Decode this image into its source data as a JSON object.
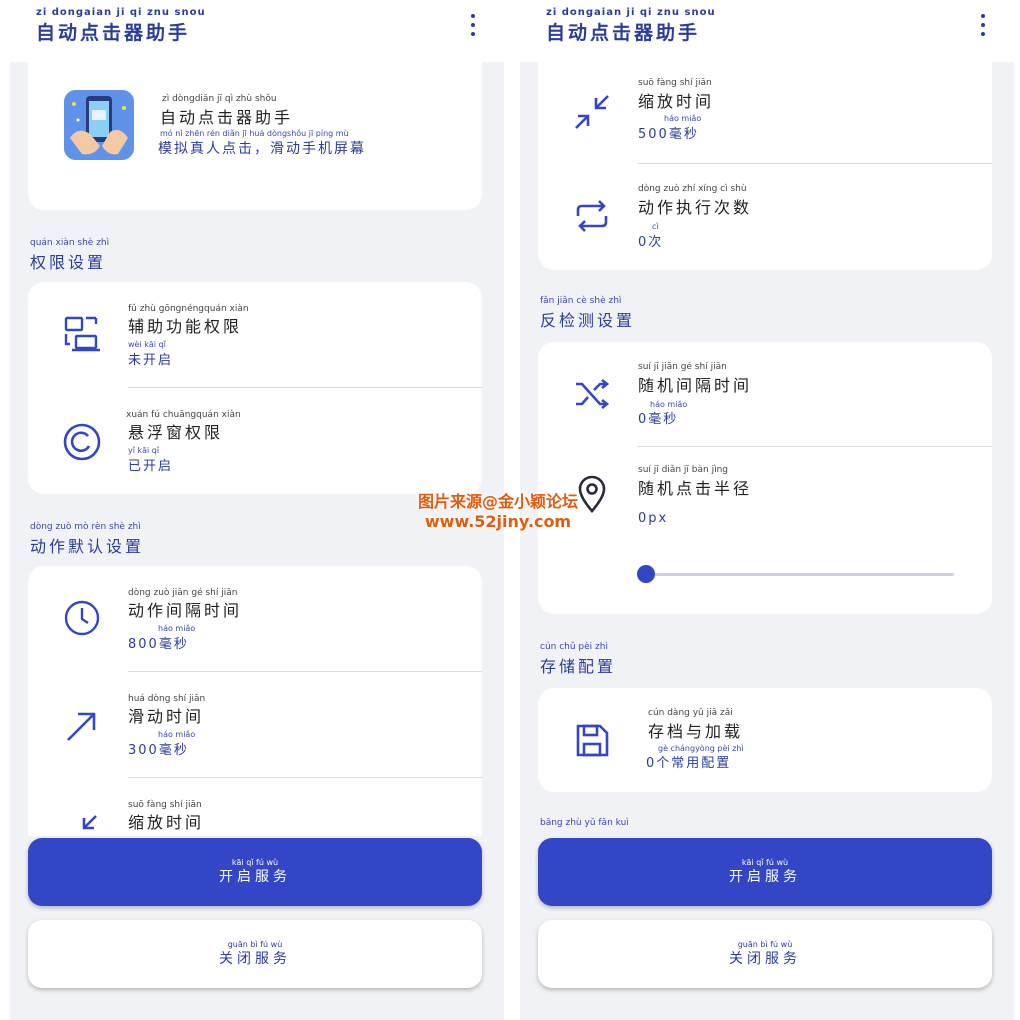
{
  "app": {
    "title_py": "zi  dongaian  ji   qi   znu snou",
    "title": "自动点击器助手"
  },
  "left": {
    "about": {
      "name_py": "zì  dòngdiǎn   jī    qì   zhù shǒu",
      "name": "自动点击器助手",
      "desc_py": "mó  nǐ  zhēn rén diǎn  jī        huá dòngshǒu   jī  píng mù",
      "desc": "模拟真人点击，滑动手机屏幕"
    },
    "perm_section": {
      "py": "quán xiàn  shè  zhì",
      "title": "权限设置"
    },
    "perm_items": [
      {
        "title_py": "fǔ   zhù  gōngnéngquán xiàn",
        "title": "辅助功能权限",
        "status_py": "wèi  kāi   qǐ",
        "status": "未开启",
        "icon": "accessibility-icon"
      },
      {
        "title_py": "xuán   fú   chuāngquán xiàn",
        "title": "悬浮窗权限",
        "status_py": "yǐ   kāi   qǐ",
        "status": "已开启",
        "icon": "float-window-icon"
      }
    ],
    "action_section": {
      "py": "dòng zuò  mò   rèn  shè  zhì",
      "title": "动作默认设置"
    },
    "action_items": [
      {
        "title_py": "dòng zuò  jiān   gé    shí  jiān",
        "title": "动作间隔时间",
        "value_py": "háo miǎo",
        "value": "800毫秒",
        "icon": "clock-icon"
      },
      {
        "title_py": "huá dòng  shí   jiān",
        "title": "滑动时间",
        "value_py": "háo miǎo",
        "value": "300毫秒",
        "icon": "swipe-arrow-icon"
      },
      {
        "title_py": "suō fàng  shí   jiān",
        "title": "缩放时间",
        "value_py": "",
        "value": "",
        "icon": "zoom-in-arrows-icon"
      }
    ]
  },
  "right": {
    "action_items": [
      {
        "title_py": "suō fàng  shí   jiān",
        "title": "缩放时间",
        "value_py": "háo miǎo",
        "value": "500毫秒",
        "icon": "zoom-in-arrows-icon"
      },
      {
        "title_py": "dòng zuò  zhí  xíng   cì   shù",
        "title": "动作执行次数",
        "value_py": "cì",
        "value": "0次",
        "icon": "repeat-icon"
      }
    ],
    "anti_section": {
      "py": "fǎn  jiǎn   cè   shè  zhì",
      "title": "反检测设置"
    },
    "anti_items": [
      {
        "title_py": "suí   jī   jiān   gé   shí  jiān",
        "title": "随机间隔时间",
        "value_py": "háo miǎo",
        "value": "0毫秒",
        "icon": "shuffle-icon"
      },
      {
        "title_py": "suí   jī   diǎn   jī   bàn  jìng",
        "title": "随机点击半径",
        "value_py": "",
        "value": "0px",
        "icon": "location-pin-icon"
      }
    ],
    "radius_slider": {
      "value": 0,
      "min": 0,
      "max": 100
    },
    "storage_section": {
      "py": "cún  chǔ  pèi  zhì",
      "title": "存储配置"
    },
    "storage_item": {
      "title_py": "cún dàng  yǔ    jiā   zǎi",
      "title": "存档与加载",
      "value_py": "gè  chángyòng pèi  zhì",
      "value": "0个常用配置",
      "icon": "save-disk-icon"
    },
    "feedback_section": {
      "py": "bāng zhù   yǔ   fǎn  kuì",
      "title": ""
    }
  },
  "buttons": {
    "start_py": "kāi   qǐ    fú   wù",
    "start": "开启服务",
    "stop_py": "guān   bì    fú   wù",
    "stop": "关闭服务"
  },
  "watermark": {
    "line1": "图片来源@金小颖论坛",
    "line2": "www.52jiny.com"
  },
  "colors": {
    "accent": "#3346c6",
    "text_blue": "#2c3c9a",
    "background": "#f1f2f5"
  }
}
